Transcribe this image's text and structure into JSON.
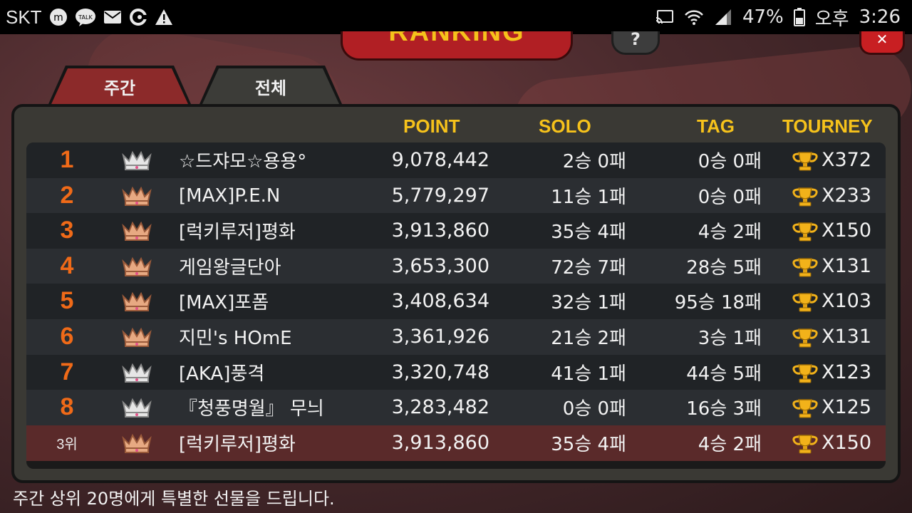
{
  "status_bar": {
    "carrier": "SKT",
    "battery": "47%",
    "ampm": "오후",
    "time": "3:26",
    "icons": [
      "line-icon",
      "talk-icon",
      "mail-icon",
      "c-icon",
      "warning-icon",
      "cast-icon",
      "wifi-icon",
      "signal-icon",
      "battery-icon"
    ]
  },
  "header": {
    "banner_title": "RANKING",
    "help_label": "?",
    "close_label": "✕"
  },
  "tabs": [
    {
      "label": "주간",
      "active": true
    },
    {
      "label": "전체",
      "active": false
    }
  ],
  "columns": {
    "point": "POINT",
    "solo": "SOLO",
    "tag": "TAG",
    "tourney": "TOURNEY"
  },
  "rows": [
    {
      "rank": "1",
      "name": "☆드쟈모☆용용°",
      "point": "9,078,442",
      "solo": "2승 0패",
      "tag": "0승 0패",
      "tourney": "X372",
      "crown": "silver"
    },
    {
      "rank": "2",
      "name": "[MAX]P.E.N",
      "point": "5,779,297",
      "solo": "11승 1패",
      "tag": "0승 0패",
      "tourney": "X233",
      "crown": "bronze"
    },
    {
      "rank": "3",
      "name": "[럭키루저]평화",
      "point": "3,913,860",
      "solo": "35승 4패",
      "tag": "4승 2패",
      "tourney": "X150",
      "crown": "bronze"
    },
    {
      "rank": "4",
      "name": "게임왕글단아",
      "point": "3,653,300",
      "solo": "72승 7패",
      "tag": "28승 5패",
      "tourney": "X131",
      "crown": "bronze"
    },
    {
      "rank": "5",
      "name": "[MAX]포폼",
      "point": "3,408,634",
      "solo": "32승 1패",
      "tag": "95승 18패",
      "tourney": "X103",
      "crown": "bronze"
    },
    {
      "rank": "6",
      "name": "지민's HOmE",
      "point": "3,361,926",
      "solo": "21승 2패",
      "tag": "3승 1패",
      "tourney": "X131",
      "crown": "bronze"
    },
    {
      "rank": "7",
      "name": "[AKA]풍격",
      "point": "3,320,748",
      "solo": "41승 1패",
      "tag": "44승 5패",
      "tourney": "X123",
      "crown": "silver"
    },
    {
      "rank": "8",
      "name": "『청풍명월』 무늬",
      "point": "3,283,482",
      "solo": "0승 0패",
      "tag": "16승 3패",
      "tourney": "X125",
      "crown": "silver"
    }
  ],
  "my_row": {
    "rank": "3위",
    "name": "[럭키루저]평화",
    "point": "3,913,860",
    "solo": "35승 4패",
    "tag": "4승 2패",
    "tourney": "X150",
    "crown": "bronze"
  },
  "footer": "주간 상위 20명에게 특별한 선물을 드립니다."
}
